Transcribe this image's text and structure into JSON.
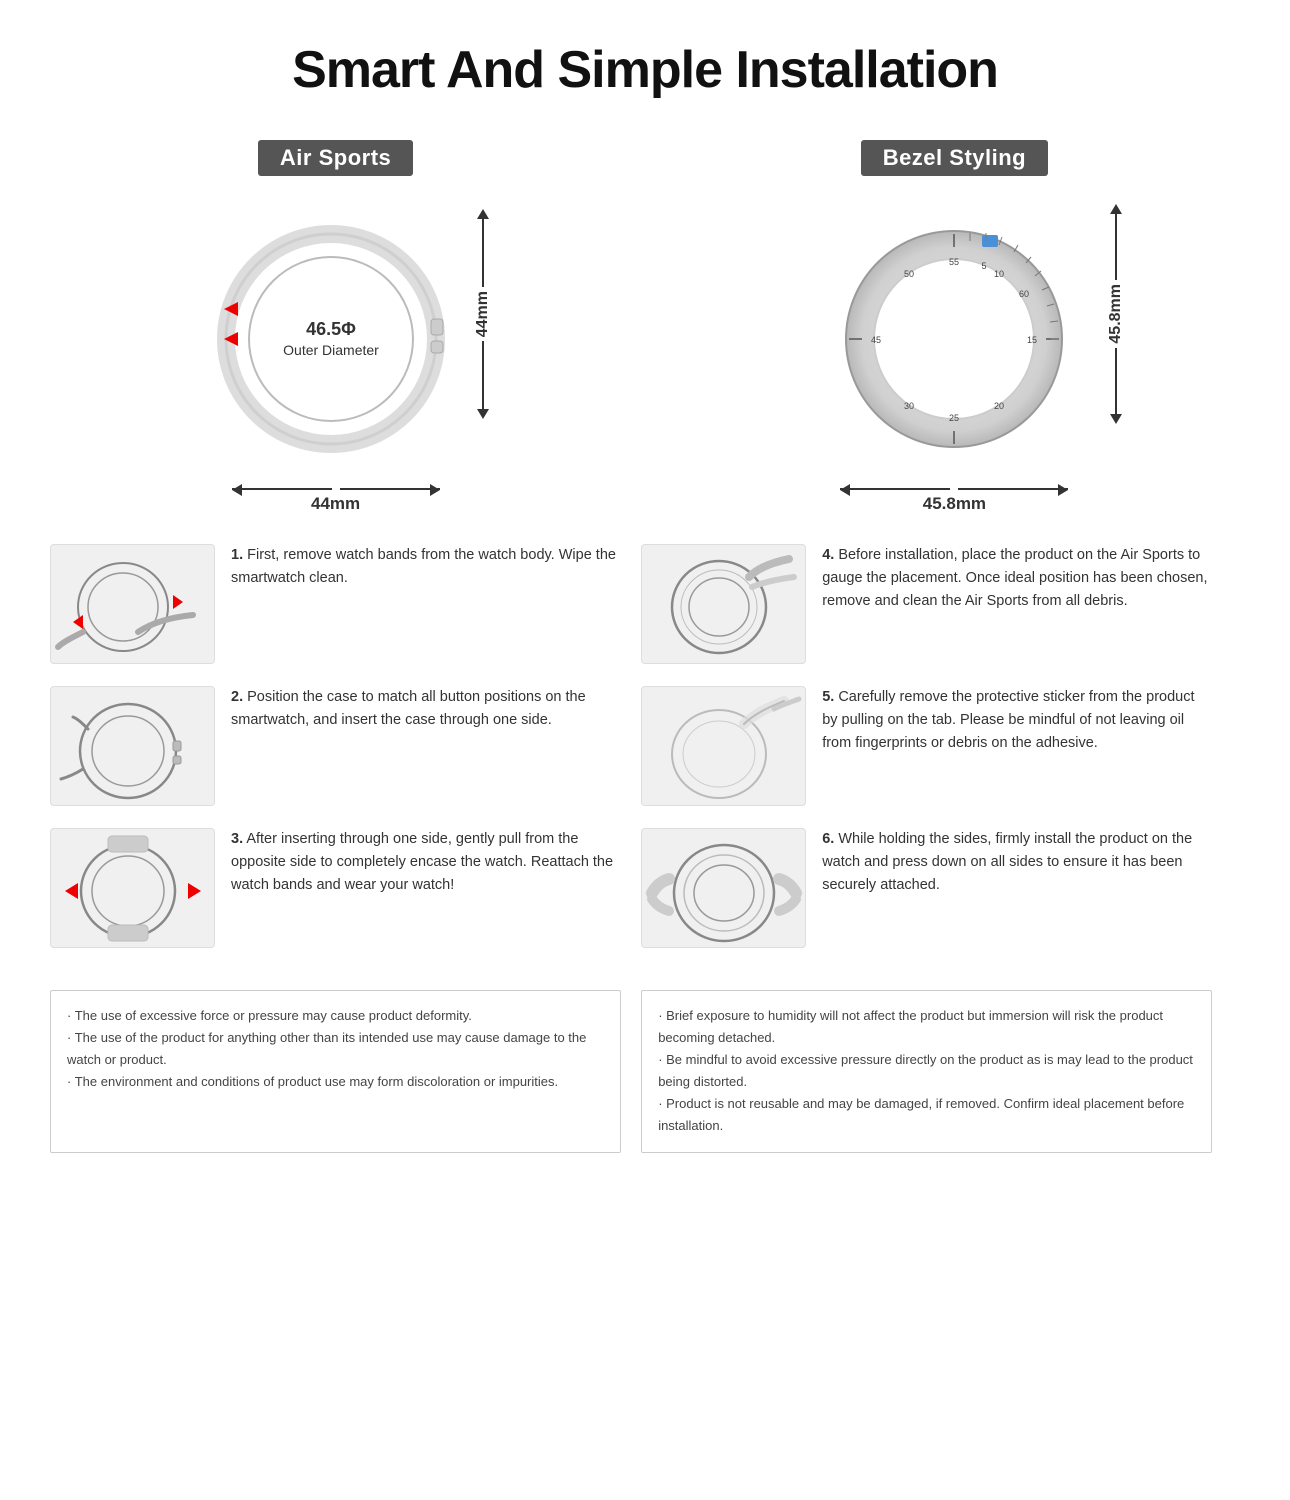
{
  "page": {
    "title": "Smart And Simple Installation",
    "product_left": {
      "label": "Air Sports",
      "diameter_text": "46.5Φ",
      "diameter_sub": "Outer Diameter",
      "width_dim": "44mm",
      "height_dim": "44mm"
    },
    "product_right": {
      "label": "Bezel Styling",
      "width_dim": "45.8mm",
      "height_dim": "45.8mm"
    },
    "steps_left": [
      {
        "num": "1.",
        "text": "First, remove watch bands from the watch body. Wipe the smartwatch clean."
      },
      {
        "num": "2.",
        "text": "Position the case to match all button positions on the smartwatch, and insert the case through one side."
      },
      {
        "num": "3.",
        "text": "After inserting through one side, gently pull from the opposite side to completely encase the watch. Reattach the watch bands and wear your watch!"
      }
    ],
    "steps_right": [
      {
        "num": "4.",
        "text": "Before installation, place the product on the Air Sports to gauge the placement. Once ideal position has been chosen, remove and clean the Air Sports from all debris."
      },
      {
        "num": "5.",
        "text": "Carefully remove the protective sticker from the product by pulling on the tab. Please be mindful of not leaving oil from fingerprints or debris on the adhesive."
      },
      {
        "num": "6.",
        "text": "While holding the sides, firmly install the product on the watch and press down on all sides to ensure it has been securely attached."
      }
    ],
    "notes_left": [
      "The use of excessive force or pressure may cause product deformity.",
      "The use of the product for anything other than its intended use may cause damage to the watch or product.",
      "The environment and conditions of product use may form discoloration or impurities."
    ],
    "notes_right": [
      "Brief exposure to humidity will not affect the product but immersion will risk the product becoming detached.",
      "Be mindful to avoid excessive pressure directly on the product as is may lead to the product being distorted.",
      "Product is not reusable and may be damaged, if removed. Confirm ideal placement before installation."
    ]
  }
}
